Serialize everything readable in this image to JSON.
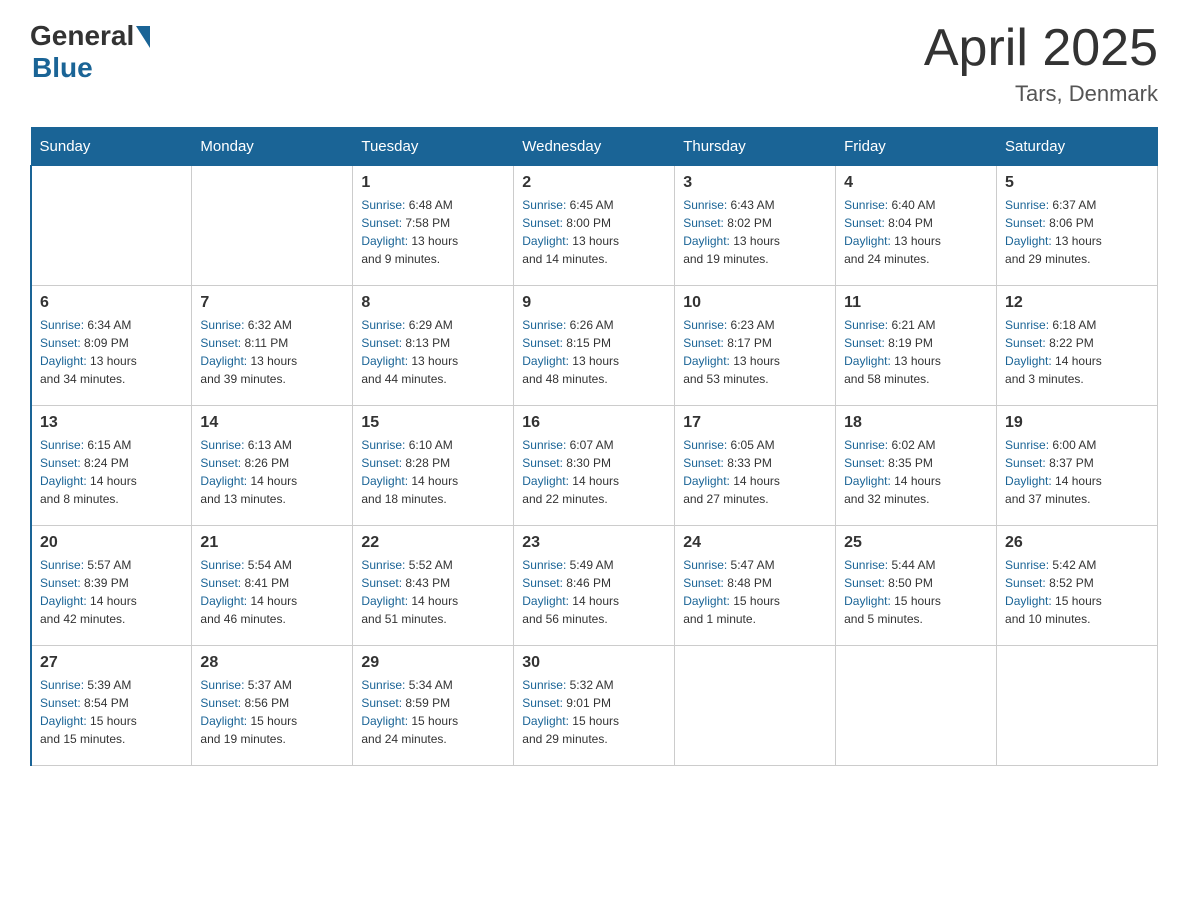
{
  "header": {
    "logo_general": "General",
    "logo_blue": "Blue",
    "title": "April 2025",
    "location": "Tars, Denmark"
  },
  "weekdays": [
    "Sunday",
    "Monday",
    "Tuesday",
    "Wednesday",
    "Thursday",
    "Friday",
    "Saturday"
  ],
  "weeks": [
    [
      {
        "day": "",
        "info": ""
      },
      {
        "day": "",
        "info": ""
      },
      {
        "day": "1",
        "info": "Sunrise: 6:48 AM\nSunset: 7:58 PM\nDaylight: 13 hours\nand 9 minutes."
      },
      {
        "day": "2",
        "info": "Sunrise: 6:45 AM\nSunset: 8:00 PM\nDaylight: 13 hours\nand 14 minutes."
      },
      {
        "day": "3",
        "info": "Sunrise: 6:43 AM\nSunset: 8:02 PM\nDaylight: 13 hours\nand 19 minutes."
      },
      {
        "day": "4",
        "info": "Sunrise: 6:40 AM\nSunset: 8:04 PM\nDaylight: 13 hours\nand 24 minutes."
      },
      {
        "day": "5",
        "info": "Sunrise: 6:37 AM\nSunset: 8:06 PM\nDaylight: 13 hours\nand 29 minutes."
      }
    ],
    [
      {
        "day": "6",
        "info": "Sunrise: 6:34 AM\nSunset: 8:09 PM\nDaylight: 13 hours\nand 34 minutes."
      },
      {
        "day": "7",
        "info": "Sunrise: 6:32 AM\nSunset: 8:11 PM\nDaylight: 13 hours\nand 39 minutes."
      },
      {
        "day": "8",
        "info": "Sunrise: 6:29 AM\nSunset: 8:13 PM\nDaylight: 13 hours\nand 44 minutes."
      },
      {
        "day": "9",
        "info": "Sunrise: 6:26 AM\nSunset: 8:15 PM\nDaylight: 13 hours\nand 48 minutes."
      },
      {
        "day": "10",
        "info": "Sunrise: 6:23 AM\nSunset: 8:17 PM\nDaylight: 13 hours\nand 53 minutes."
      },
      {
        "day": "11",
        "info": "Sunrise: 6:21 AM\nSunset: 8:19 PM\nDaylight: 13 hours\nand 58 minutes."
      },
      {
        "day": "12",
        "info": "Sunrise: 6:18 AM\nSunset: 8:22 PM\nDaylight: 14 hours\nand 3 minutes."
      }
    ],
    [
      {
        "day": "13",
        "info": "Sunrise: 6:15 AM\nSunset: 8:24 PM\nDaylight: 14 hours\nand 8 minutes."
      },
      {
        "day": "14",
        "info": "Sunrise: 6:13 AM\nSunset: 8:26 PM\nDaylight: 14 hours\nand 13 minutes."
      },
      {
        "day": "15",
        "info": "Sunrise: 6:10 AM\nSunset: 8:28 PM\nDaylight: 14 hours\nand 18 minutes."
      },
      {
        "day": "16",
        "info": "Sunrise: 6:07 AM\nSunset: 8:30 PM\nDaylight: 14 hours\nand 22 minutes."
      },
      {
        "day": "17",
        "info": "Sunrise: 6:05 AM\nSunset: 8:33 PM\nDaylight: 14 hours\nand 27 minutes."
      },
      {
        "day": "18",
        "info": "Sunrise: 6:02 AM\nSunset: 8:35 PM\nDaylight: 14 hours\nand 32 minutes."
      },
      {
        "day": "19",
        "info": "Sunrise: 6:00 AM\nSunset: 8:37 PM\nDaylight: 14 hours\nand 37 minutes."
      }
    ],
    [
      {
        "day": "20",
        "info": "Sunrise: 5:57 AM\nSunset: 8:39 PM\nDaylight: 14 hours\nand 42 minutes."
      },
      {
        "day": "21",
        "info": "Sunrise: 5:54 AM\nSunset: 8:41 PM\nDaylight: 14 hours\nand 46 minutes."
      },
      {
        "day": "22",
        "info": "Sunrise: 5:52 AM\nSunset: 8:43 PM\nDaylight: 14 hours\nand 51 minutes."
      },
      {
        "day": "23",
        "info": "Sunrise: 5:49 AM\nSunset: 8:46 PM\nDaylight: 14 hours\nand 56 minutes."
      },
      {
        "day": "24",
        "info": "Sunrise: 5:47 AM\nSunset: 8:48 PM\nDaylight: 15 hours\nand 1 minute."
      },
      {
        "day": "25",
        "info": "Sunrise: 5:44 AM\nSunset: 8:50 PM\nDaylight: 15 hours\nand 5 minutes."
      },
      {
        "day": "26",
        "info": "Sunrise: 5:42 AM\nSunset: 8:52 PM\nDaylight: 15 hours\nand 10 minutes."
      }
    ],
    [
      {
        "day": "27",
        "info": "Sunrise: 5:39 AM\nSunset: 8:54 PM\nDaylight: 15 hours\nand 15 minutes."
      },
      {
        "day": "28",
        "info": "Sunrise: 5:37 AM\nSunset: 8:56 PM\nDaylight: 15 hours\nand 19 minutes."
      },
      {
        "day": "29",
        "info": "Sunrise: 5:34 AM\nSunset: 8:59 PM\nDaylight: 15 hours\nand 24 minutes."
      },
      {
        "day": "30",
        "info": "Sunrise: 5:32 AM\nSunset: 9:01 PM\nDaylight: 15 hours\nand 29 minutes."
      },
      {
        "day": "",
        "info": ""
      },
      {
        "day": "",
        "info": ""
      },
      {
        "day": "",
        "info": ""
      }
    ]
  ]
}
